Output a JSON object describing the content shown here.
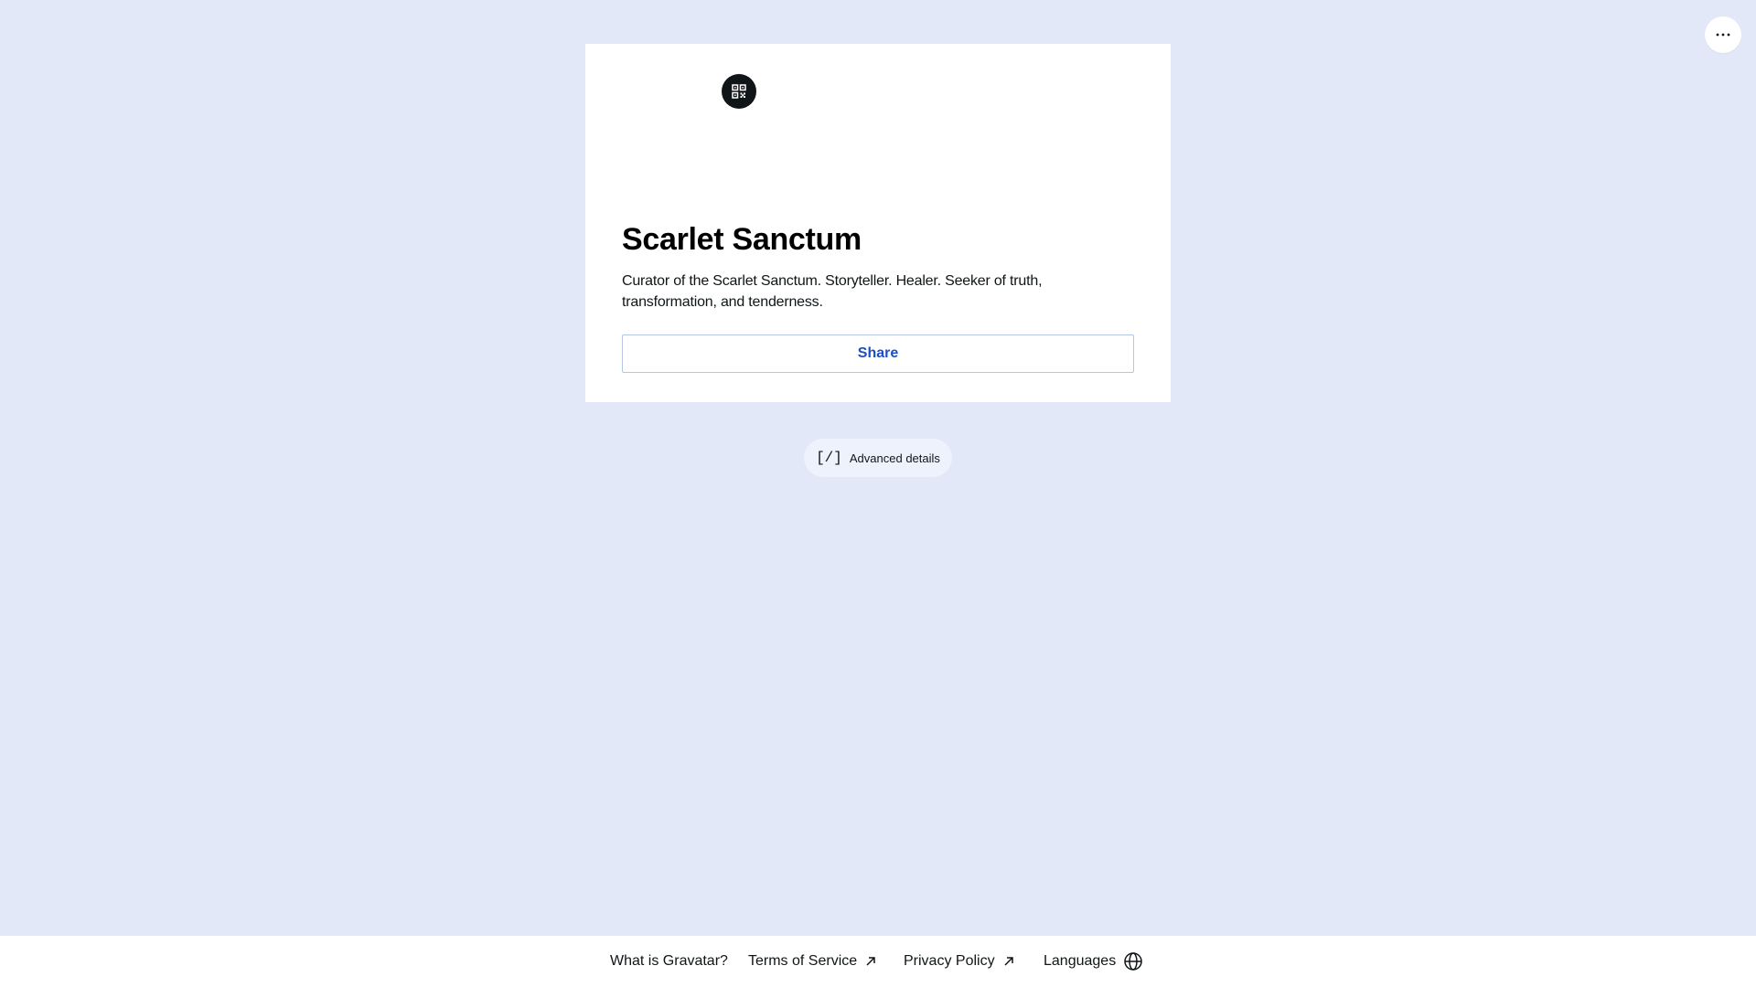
{
  "menu": {
    "icon": "more-horizontal-icon"
  },
  "profile": {
    "qr_icon": "qr-code-icon",
    "display_name": "Scarlet Sanctum",
    "bio": "Curator of the Scarlet Sanctum. Storyteller. Healer. Seeker of truth, transformation, and tenderness.",
    "share_label": "Share"
  },
  "advanced": {
    "icon_text": "[/]",
    "label": "Advanced details"
  },
  "footer": {
    "what_is": "What is Gravatar?",
    "terms": "Terms of Service",
    "privacy": "Privacy Policy",
    "languages": "Languages",
    "external_icon": "arrow-up-right-icon",
    "globe_icon": "globe-icon"
  },
  "colors": {
    "page_background": "#e2e8f8",
    "card_background": "#ffffff",
    "accent_blue": "#1d4fc4",
    "share_border": "#b6c5e6",
    "dark": "#101517"
  }
}
